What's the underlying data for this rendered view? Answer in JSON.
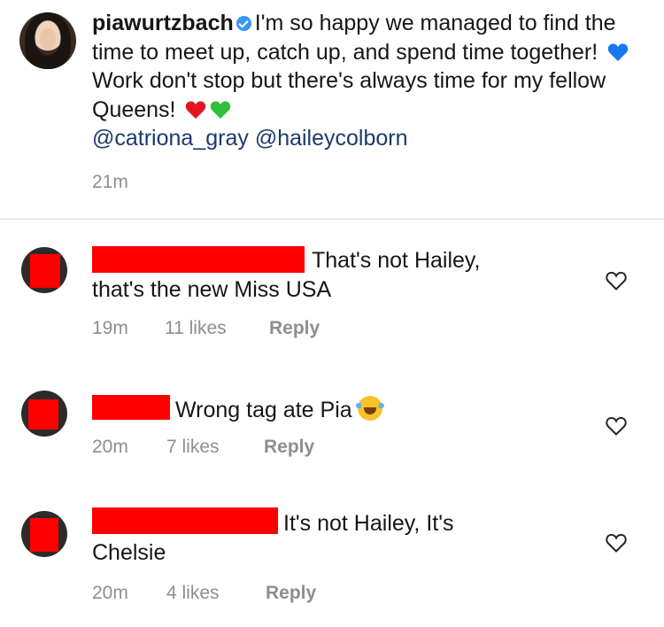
{
  "post": {
    "username": "piawurtzbach",
    "caption_part1": "I'm so happy we managed to find the time to meet up, catch up, and spend time together!",
    "caption_part2": "Work don't stop but there's always time for my fellow Queens!",
    "mention1": "@catriona_gray",
    "mention2": "@haileycolborn",
    "timestamp": "21m",
    "icons": [
      "verified-icon",
      "blue-heart-icon",
      "red-heart-icon",
      "green-heart-icon"
    ],
    "colors": {
      "blue_heart": "#1877f2",
      "red_heart": "#e0161f",
      "green_heart": "#2fbf3a"
    }
  },
  "comments": [
    {
      "text_line1": "That's not Hailey,",
      "text_line2": "that's the new Miss USA",
      "time": "19m",
      "likes": "11 likes",
      "reply": "Reply"
    },
    {
      "text_line1": "Wrong tag ate Pia",
      "time": "20m",
      "likes": "7 likes",
      "reply": "Reply",
      "emoji": "laughing-tears-emoji"
    },
    {
      "text_line1": "It's not Hailey, It's",
      "text_line2": "Chelsie",
      "time": "20m",
      "likes": "4 likes",
      "reply": "Reply"
    }
  ],
  "redaction_color": "#ff0000"
}
